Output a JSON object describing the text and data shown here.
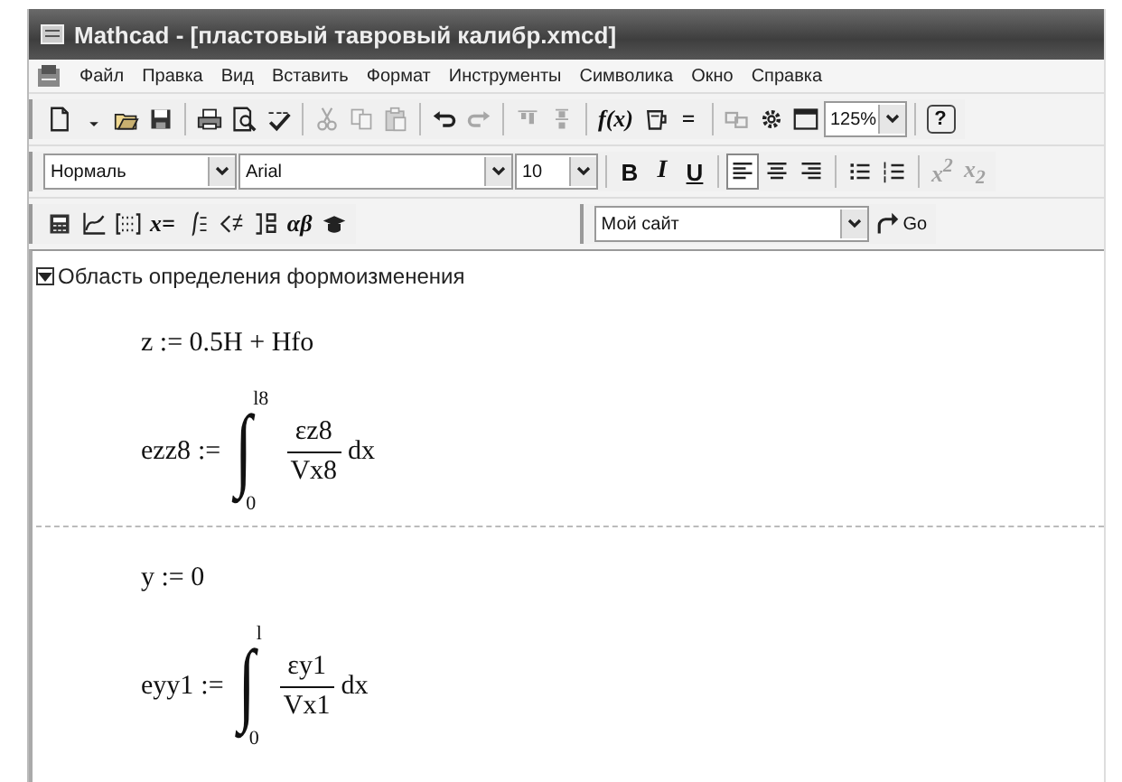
{
  "window": {
    "title": "Mathcad - [пластовый тавровый калибр.xmcd]"
  },
  "menu": [
    "Файл",
    "Правка",
    "Вид",
    "Вставить",
    "Формат",
    "Инструменты",
    "Символика",
    "Окно",
    "Справка"
  ],
  "toolbar_rows": [
    {
      "toolbars": [
        {
          "items": [
            {
              "kind": "new",
              "disabled": false
            },
            {
              "kind": "caret",
              "disabled": false
            },
            {
              "kind": "open",
              "disabled": false
            },
            {
              "kind": "save",
              "disabled": false
            },
            {
              "kind": "separator"
            },
            {
              "kind": "print",
              "disabled": false
            },
            {
              "kind": "preview",
              "disabled": false
            },
            {
              "kind": "spell",
              "disabled": false
            },
            {
              "kind": "separator"
            },
            {
              "kind": "cut",
              "disabled": true
            },
            {
              "kind": "copy",
              "disabled": true
            },
            {
              "kind": "paste",
              "disabled": true
            },
            {
              "kind": "separator"
            },
            {
              "kind": "undo",
              "disabled": false
            },
            {
              "kind": "redo",
              "disabled": true
            },
            {
              "kind": "separator"
            },
            {
              "kind": "align-top",
              "disabled": true
            },
            {
              "kind": "align-bottom",
              "disabled": true
            },
            {
              "kind": "separator"
            },
            {
              "kind": "label",
              "label": "f(x)",
              "disabled": false
            },
            {
              "kind": "units",
              "disabled": false
            },
            {
              "kind": "label",
              "label": "=",
              "disabled": false
            },
            {
              "kind": "separator"
            },
            {
              "kind": "components",
              "disabled": true
            },
            {
              "kind": "resources",
              "disabled": false
            },
            {
              "kind": "window",
              "disabled": false
            },
            {
              "kind": "dropdown",
              "value": "125%"
            },
            {
              "kind": "separator"
            },
            {
              "kind": "help",
              "label": "?",
              "disabled": false
            }
          ]
        }
      ]
    },
    {
      "toolbars": [
        {
          "items": [
            {
              "kind": "dropdown",
              "value": "Нормаль"
            },
            {
              "kind": "dropdown",
              "value": "Arial"
            },
            {
              "kind": "dropdown",
              "value": "10"
            },
            {
              "kind": "separator"
            },
            {
              "kind": "bold",
              "label": "B",
              "disabled": false
            },
            {
              "kind": "italic",
              "label": "I",
              "disabled": false
            },
            {
              "kind": "underline",
              "label": "U",
              "disabled": false
            },
            {
              "kind": "separator"
            },
            {
              "kind": "align-left",
              "disabled": false,
              "selected": true
            },
            {
              "kind": "align-center",
              "disabled": false,
              "selected": false
            },
            {
              "kind": "align-right",
              "disabled": false,
              "selected": false
            },
            {
              "kind": "separator"
            },
            {
              "kind": "bullets",
              "disabled": false
            },
            {
              "kind": "numbering",
              "disabled": false
            },
            {
              "kind": "separator"
            },
            {
              "kind": "label",
              "label": "x$^{2}$",
              "disabled": true
            },
            {
              "kind": "label",
              "label": "x$_{2}$",
              "disabled": true
            }
          ]
        }
      ]
    },
    {
      "toolbars": [
        {
          "items": [
            {
              "kind": "calculator",
              "disabled": false
            },
            {
              "kind": "graph",
              "disabled": false
            },
            {
              "kind": "matrix",
              "disabled": false
            },
            {
              "kind": "label",
              "label": "x=",
              "disabled": false
            },
            {
              "kind": "calculus",
              "disabled": false
            },
            {
              "kind": "boolean",
              "disabled": false
            },
            {
              "kind": "programming",
              "disabled": false
            },
            {
              "kind": "label",
              "label": "αβ",
              "disabled": false
            },
            {
              "kind": "symbolic",
              "disabled": false
            }
          ]
        },
        {
          "items": [
            {
              "kind": "dropdown",
              "value": "Мой сайт"
            },
            {
              "kind": "go",
              "label": "Go",
              "disabled": false
            }
          ]
        }
      ]
    }
  ],
  "region": {
    "title": "Область определения формоизменения",
    "expanded": true
  },
  "sections": [
    {
      "blocks": [
        {
          "kind": "assign",
          "lhs": "z",
          "op": ":=",
          "rhs": "0.5H + Hfo"
        },
        {
          "kind": "integral",
          "lhs": "ezz8",
          "op": ":=",
          "sign": "∫",
          "upper": "l8",
          "lower": "0",
          "numerator": "εz8",
          "denominator": "Vx8",
          "differential": "dx"
        }
      ]
    },
    {
      "blocks": [
        {
          "kind": "assign",
          "lhs": "y",
          "op": ":=",
          "rhs": "0"
        },
        {
          "kind": "integral",
          "lhs": "eyy1",
          "op": ":=",
          "sign": "∫",
          "upper": "l",
          "lower": "0",
          "numerator": "εy1",
          "denominator": "Vx1",
          "differential": "dx"
        }
      ]
    }
  ]
}
